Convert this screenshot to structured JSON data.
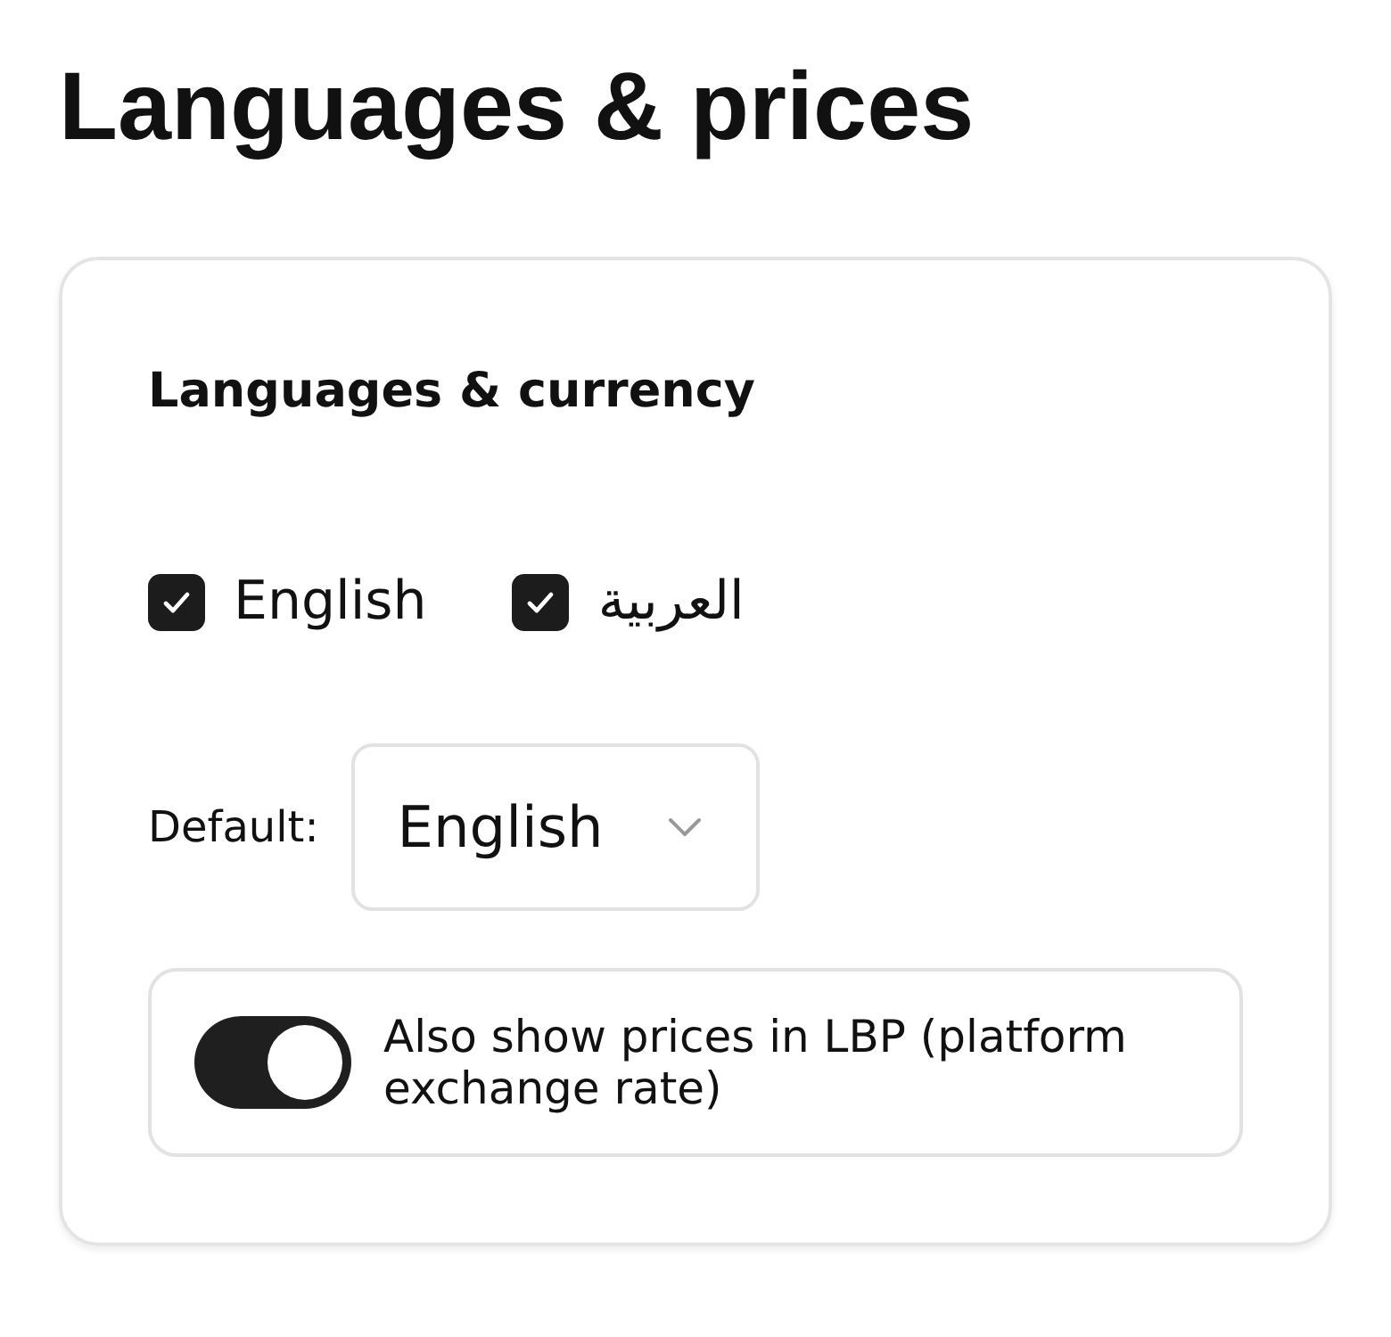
{
  "title": "Languages & prices",
  "card": {
    "heading": "Languages & currency",
    "languages": [
      {
        "label": "English",
        "checked": true
      },
      {
        "label": "العربية",
        "checked": true
      }
    ],
    "default": {
      "label": "Default:",
      "value": "English"
    },
    "lbp_toggle": {
      "label": "Also show prices in LBP (platform exchange rate)",
      "on": true
    }
  }
}
